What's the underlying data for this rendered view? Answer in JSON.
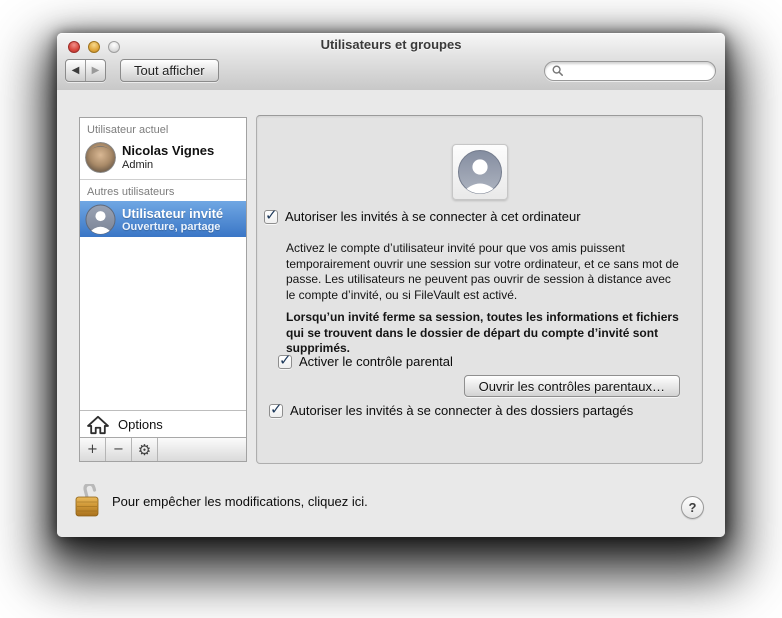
{
  "window": {
    "title": "Utilisateurs et groupes"
  },
  "toolbar": {
    "back_icon": "◀",
    "forward_icon": "▶",
    "show_all_label": "Tout afficher",
    "search_value": ""
  },
  "icons": {
    "plus": "+",
    "minus": "−",
    "gear": "⚙",
    "help": "?",
    "check": "✓"
  },
  "sidebar": {
    "current_user_header": "Utilisateur actuel",
    "current_user": {
      "name": "Nicolas Vignes",
      "role": "Admin"
    },
    "other_users_header": "Autres utilisateurs",
    "other_users": [
      {
        "name": "Utilisateur invité",
        "detail": "Ouverture, partage",
        "selected": true
      }
    ],
    "options_label": "Options"
  },
  "main": {
    "checkbox_connect_label": "Autoriser les invités à se connecter à cet ordinateur",
    "checkbox_connect_checked": true,
    "description": "Activez le compte d’utilisateur invité pour que vos amis puissent temporairement ouvrir une session sur votre ordinateur, et ce sans mot de passe. Les utilisateurs ne peuvent pas ouvrir de session à distance avec le compte d’invité, ou si FileVault est activé.",
    "warning": "Lorsqu’un invité ferme sa session, toutes les informations et fichiers qui se trouvent dans le dossier de départ du compte d’invité sont supprimés.",
    "checkbox_parental_label": "Activer le contrôle parental",
    "checkbox_parental_checked": true,
    "parental_button_label": "Ouvrir les contrôles parentaux…",
    "checkbox_shared_label": "Autoriser les invités à se connecter à des dossiers partagés",
    "checkbox_shared_checked": true
  },
  "footer": {
    "lock_text": "Pour empêcher les modifications, cliquez ici."
  },
  "colors": {
    "selection_top": "#70a7e3",
    "selection_bottom": "#3a76c6",
    "check": "#1e3a5c",
    "chrome_top": "#f7f7f7",
    "chrome_bottom": "#c8c8c8",
    "panel_bg": "#e3e3e3",
    "content_bg": "#e9e9e9"
  }
}
